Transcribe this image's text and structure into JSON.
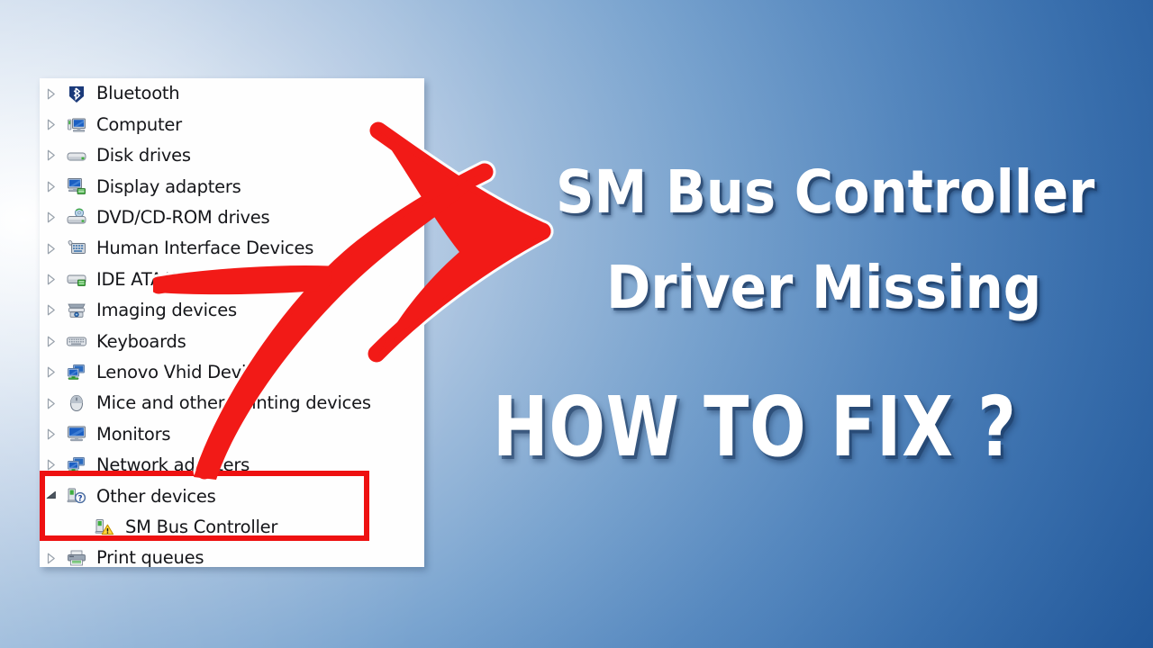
{
  "background": {
    "gradient_from": "#ffffff",
    "gradient_to": "#1e569c",
    "accent_red": "#ee1111"
  },
  "device_manager": {
    "panel_label": "Device Manager device tree",
    "tree": [
      {
        "label": "Bluetooth",
        "icon": "bluetooth-icon",
        "expander": "collapsed",
        "level": 0
      },
      {
        "label": "Computer",
        "icon": "computer-icon",
        "expander": "collapsed",
        "level": 0
      },
      {
        "label": "Disk drives",
        "icon": "disk-drive-icon",
        "expander": "collapsed",
        "level": 0
      },
      {
        "label": "Display adapters",
        "icon": "display-adapter-icon",
        "expander": "collapsed",
        "level": 0
      },
      {
        "label": "DVD/CD-ROM drives",
        "icon": "dvd-drive-icon",
        "expander": "collapsed",
        "level": 0
      },
      {
        "label": "Human Interface Devices",
        "icon": "hid-icon",
        "expander": "collapsed",
        "level": 0
      },
      {
        "label": "IDE ATA/ATAPI controllers",
        "icon": "ide-controller-icon",
        "expander": "collapsed",
        "level": 0
      },
      {
        "label": "Imaging devices",
        "icon": "imaging-device-icon",
        "expander": "collapsed",
        "level": 0
      },
      {
        "label": "Keyboards",
        "icon": "keyboard-icon",
        "expander": "collapsed",
        "level": 0
      },
      {
        "label": "Lenovo Vhid Device",
        "icon": "network-device-icon",
        "expander": "collapsed",
        "level": 0
      },
      {
        "label": "Mice and other pointing devices",
        "icon": "mouse-icon",
        "expander": "collapsed",
        "level": 0
      },
      {
        "label": "Monitors",
        "icon": "monitor-icon",
        "expander": "collapsed",
        "level": 0
      },
      {
        "label": "Network adapters",
        "icon": "network-adapter-icon",
        "expander": "collapsed",
        "level": 0
      },
      {
        "label": "Other devices",
        "icon": "unknown-device-icon",
        "expander": "expanded",
        "level": 0
      },
      {
        "label": "SM Bus Controller",
        "icon": "warning-device-icon",
        "expander": "none",
        "level": 1
      },
      {
        "label": "Print queues",
        "icon": "printer-icon",
        "expander": "collapsed",
        "level": 0
      }
    ]
  },
  "annotations": {
    "highlight_box_label": "Other devices highlight",
    "arrow_label": "red-arrow-pointing-right"
  },
  "headline": {
    "line1": "SM Bus Controller",
    "line2": "Driver Missing",
    "line3": "HOW TO FIX ?"
  }
}
